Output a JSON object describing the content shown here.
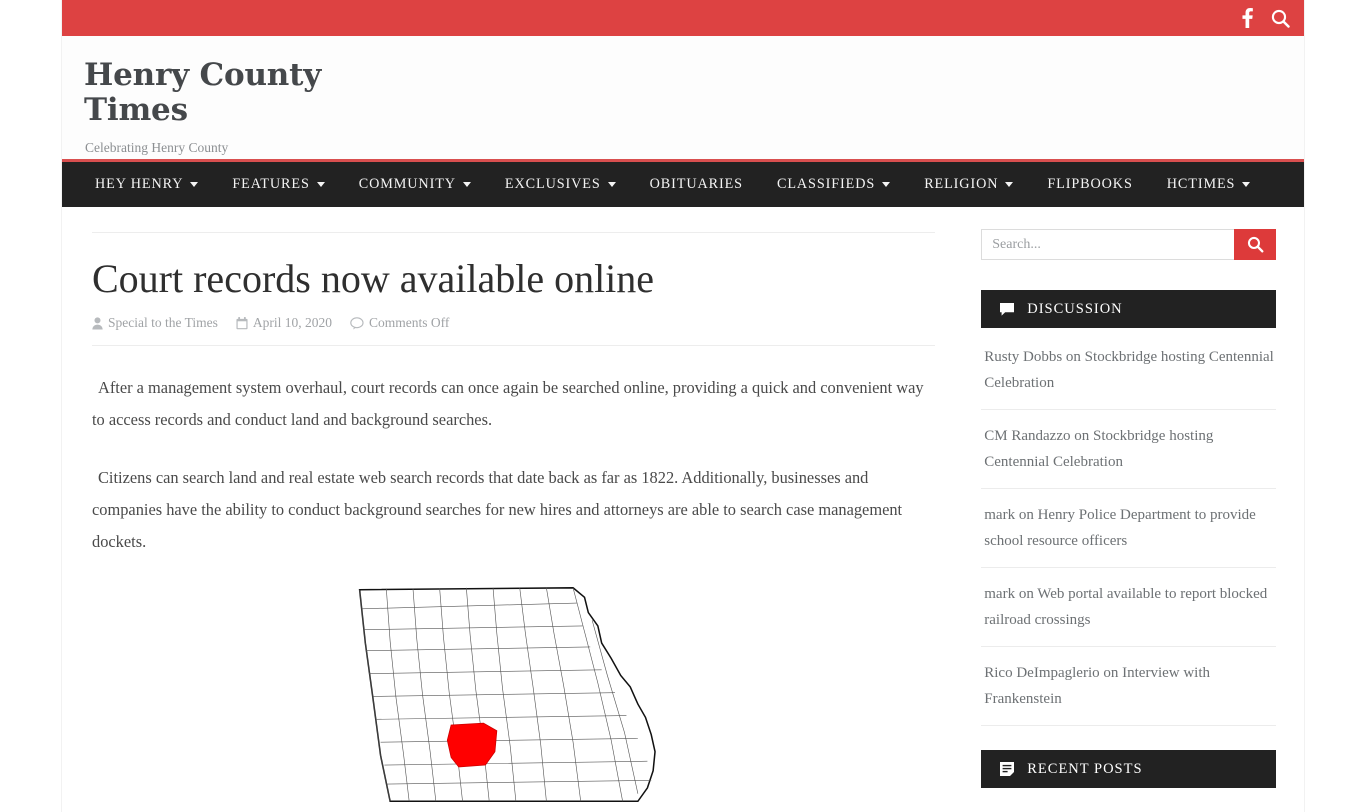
{
  "topbar": {
    "icons": [
      {
        "name": "facebook-icon",
        "label": "f"
      },
      {
        "name": "search-icon",
        "label": "Search"
      }
    ]
  },
  "masthead": {
    "site_title": "Henry County Times",
    "tagline": "Celebrating Henry County"
  },
  "nav": {
    "items": [
      {
        "label": "HEY HENRY",
        "has_dropdown": true
      },
      {
        "label": "FEATURES",
        "has_dropdown": true
      },
      {
        "label": "COMMUNITY",
        "has_dropdown": true
      },
      {
        "label": "EXCLUSIVES",
        "has_dropdown": true
      },
      {
        "label": "OBITUARIES",
        "has_dropdown": false
      },
      {
        "label": "CLASSIFIEDS",
        "has_dropdown": true
      },
      {
        "label": "RELIGION",
        "has_dropdown": true
      },
      {
        "label": "FLIPBOOKS",
        "has_dropdown": false
      },
      {
        "label": "HCTIMES",
        "has_dropdown": true
      }
    ]
  },
  "article": {
    "title": "Court records now available online",
    "author": "Special to the Times",
    "date": "April 10, 2020",
    "comments": "Comments Off",
    "paragraphs": [
      "After a management system overhaul, court records can once again be searched online, providing a quick and convenient way to access records and conduct land and background searches.",
      "Citizens can search land and real estate web search records that date back as far as 1822. Additionally, businesses and companies have the ability to conduct background searches for new hires and attorneys are able to search case management dockets."
    ],
    "figure_alt": "Map of Georgia counties with Henry County highlighted in red"
  },
  "sidebar": {
    "search": {
      "placeholder": "Search...",
      "value": ""
    },
    "discussion": {
      "title": "DISCUSSION",
      "comments": [
        "Rusty Dobbs on Stockbridge hosting Centennial Celebration",
        "CM Randazzo on Stockbridge hosting Centennial Celebration",
        "mark on Henry Police Department to provide school resource officers",
        "mark on Web portal available to report blocked railroad crossings",
        "Rico DeImpaglerio on Interview with Frankenstein"
      ]
    },
    "recent_posts": {
      "title": "RECENT POSTS"
    }
  },
  "colors": {
    "brand_red": "#dd4242",
    "search_red": "#dd3a3a",
    "nav_dark": "#222222",
    "title_gray": "#45484b",
    "county_highlight": "#ff0000"
  }
}
